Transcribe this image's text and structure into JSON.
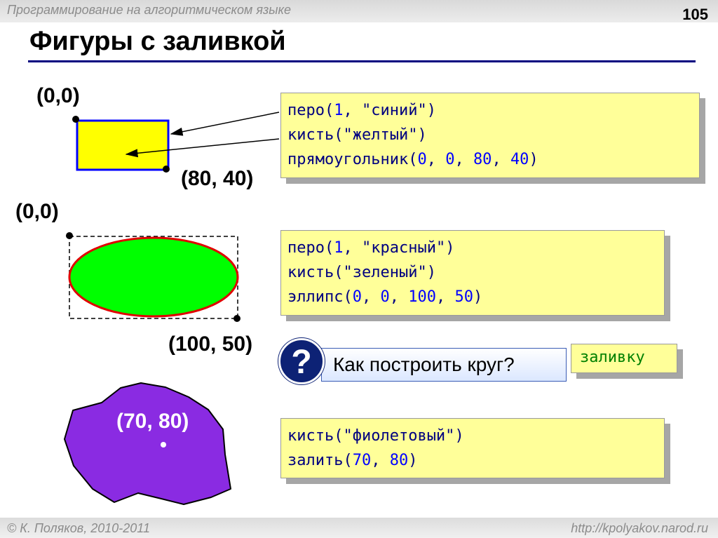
{
  "header": {
    "subtitle": "Программирование на алгоритмическом языке",
    "page_number": "105"
  },
  "title": "Фигуры с заливкой",
  "rectangle": {
    "coord_start": "(0,0)",
    "coord_end": "(80, 40)",
    "fill_color": "#ffff00",
    "stroke_color": "#0000ff",
    "code": [
      {
        "fn": "перо",
        "args": [
          {
            "t": "num",
            "v": "1"
          },
          {
            "t": "str",
            "v": "\"синий\""
          }
        ]
      },
      {
        "fn": "кисть",
        "args": [
          {
            "t": "str",
            "v": "\"желтый\""
          }
        ]
      },
      {
        "fn": "прямоугольник",
        "args": [
          {
            "t": "num",
            "v": "0"
          },
          {
            "t": "num",
            "v": "0"
          },
          {
            "t": "num",
            "v": "80"
          },
          {
            "t": "num",
            "v": "40"
          }
        ]
      }
    ]
  },
  "ellipse": {
    "coord_start": "(0,0)",
    "coord_end": "(100, 50)",
    "fill_color": "#00ff00",
    "stroke_color": "#e00000",
    "code": [
      {
        "fn": "перо",
        "args": [
          {
            "t": "num",
            "v": "1"
          },
          {
            "t": "str",
            "v": "\"красный\""
          }
        ]
      },
      {
        "fn": "кисть",
        "args": [
          {
            "t": "str",
            "v": "\"зеленый\""
          }
        ]
      },
      {
        "fn": "эллипс",
        "args": [
          {
            "t": "num",
            "v": "0"
          },
          {
            "t": "num",
            "v": "0"
          },
          {
            "t": "num",
            "v": "100"
          },
          {
            "t": "num",
            "v": "50"
          }
        ]
      }
    ]
  },
  "question": {
    "glyph": "?",
    "text": "Как построить круг?",
    "answer": "заливку"
  },
  "fill_shape": {
    "point_label": "(70, 80)",
    "fill_color": "#8a2be2",
    "code": [
      {
        "fn": "кисть",
        "args": [
          {
            "t": "str",
            "v": "\"фиолетовый\""
          }
        ]
      },
      {
        "fn": "залить",
        "args": [
          {
            "t": "num",
            "v": "70"
          },
          {
            "t": "num",
            "v": "80"
          }
        ]
      }
    ]
  },
  "footer": {
    "copyright": "© К. Поляков, 2010-2011",
    "url": "http://kpolyakov.narod.ru"
  }
}
